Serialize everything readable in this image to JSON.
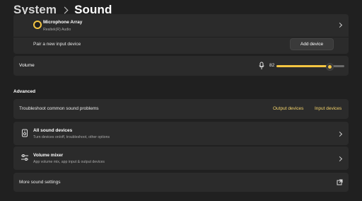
{
  "header": {
    "breadcrumb_parent": "System",
    "current_page": "Sound"
  },
  "input": {
    "device_name": "Microphone Array",
    "device_subtitle": "Realtek(R) Audio",
    "pair_label": "Pair a new input device",
    "add_device_label": "Add device",
    "volume_label": "Volume",
    "volume_value": "82",
    "volume_level": 82
  },
  "advanced": {
    "section_title": "Advanced",
    "troubleshoot_label": "Troubleshoot common sound problems",
    "output_devices_link": "Output devices",
    "input_devices_link": "Input devices",
    "all_sound_devices_title": "All sound devices",
    "all_sound_devices_subtitle": "Turn devices on/off, troubleshoot, other options",
    "volume_mixer_title": "Volume mixer",
    "volume_mixer_subtitle": "App volume mix, app input & output devices",
    "more_sound_settings_label": "More sound settings"
  },
  "colors": {
    "accent": "#f4c542",
    "background": "#202020",
    "card": "#2b2b2b"
  },
  "icons": {
    "radio_selected": "radio-button-selected-icon",
    "mic": "microphone-icon",
    "speaker": "speaker-device-icon",
    "mixer": "mixer-sliders-icon",
    "external": "open-external-icon"
  }
}
